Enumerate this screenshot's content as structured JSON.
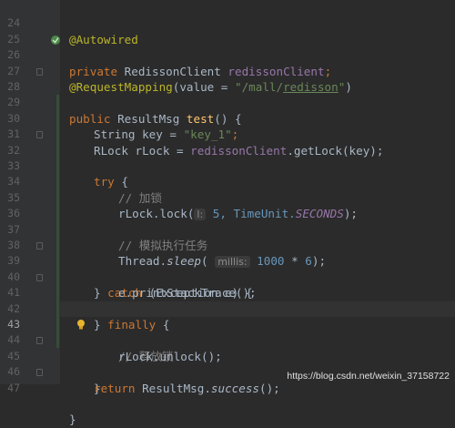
{
  "editor": {
    "lines": [
      {
        "num": "24"
      },
      {
        "num": "25"
      },
      {
        "num": "26"
      },
      {
        "num": "27"
      },
      {
        "num": "28"
      },
      {
        "num": "29"
      },
      {
        "num": "30"
      },
      {
        "num": "31"
      },
      {
        "num": "32"
      },
      {
        "num": "33"
      },
      {
        "num": "34"
      },
      {
        "num": "35"
      },
      {
        "num": "36"
      },
      {
        "num": "37"
      },
      {
        "num": "38"
      },
      {
        "num": "39"
      },
      {
        "num": "40"
      },
      {
        "num": "41"
      },
      {
        "num": "42"
      },
      {
        "num": "43"
      },
      {
        "num": "44"
      },
      {
        "num": "45"
      },
      {
        "num": "46"
      },
      {
        "num": "47"
      }
    ],
    "tokens": {
      "autowired": "@Autowired",
      "private": "private",
      "redisson_type": " RedissonClient ",
      "redisson_field": "redissonClient",
      "semi": ";",
      "request_mapping": "@RequestMapping",
      "value_attr": "(value = ",
      "path_q1": "\"/mall/",
      "path_word": "redisson",
      "path_q2": "\"",
      "close_paren": ")",
      "public": "public",
      "result_type": " ResultMsg ",
      "test_fn": "test",
      "test_sig": "() {",
      "string_decl": "String key = ",
      "key_value": "\"key_1\"",
      "rlock_decl": "RLock rLock = ",
      "get_lock": ".getLock(key);",
      "try": "try",
      "brace_open": " {",
      "comment_lock": "// 加锁",
      "lock_call_1": "rLock.lock(",
      "hint_l": "l:",
      "lock_call_2": " 5, TimeUnit.",
      "seconds": "SECONDS",
      "lock_call_3": ");",
      "comment_task": "// 模拟执行任务",
      "thread_sleep_1": "Thread.",
      "sleep": "sleep",
      "paren_open": "(",
      "hint_millis": "millis:",
      "thread_sleep_nums": "1000",
      "times": " * ",
      "six": "6",
      "thread_sleep_end": ");",
      "catch_line_1": "} ",
      "catch": "catch",
      "catch_line_2": " (Exception e) {",
      "print_trace": "e.printStackTrace();",
      "finally_1": "} ",
      "finally": "finally",
      "finally_2": " {",
      "comment_release": "// 释放锁",
      "unlock": "rLock.unlock();",
      "close_brace": "}",
      "return": "return",
      "return_2": " ResultMsg.",
      "success": "success",
      "return_3": "();"
    }
  },
  "watermark": "https://blog.csdn.net/weixin_37158722",
  "colors": {
    "background": "#2b2b2b",
    "gutter": "#313335",
    "keyword": "#cc7832",
    "string": "#6a8759",
    "field": "#9876aa",
    "annotation": "#bbb529",
    "comment": "#808080",
    "number": "#6897bb"
  }
}
